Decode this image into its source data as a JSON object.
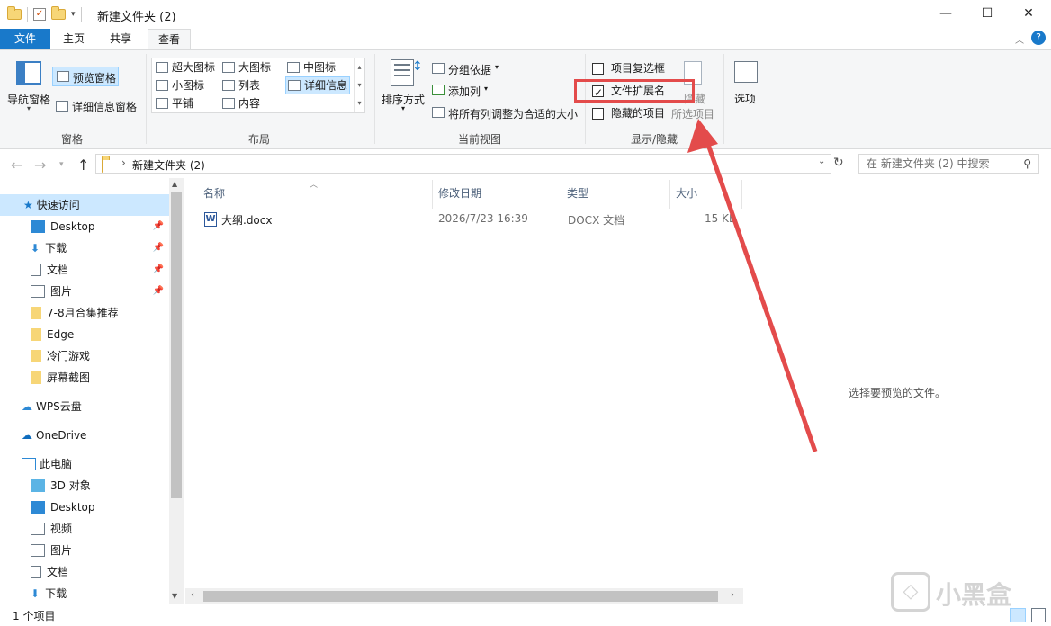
{
  "title": "新建文件夹 (2)",
  "window_controls": {
    "minimize": "—",
    "maximize": "☐",
    "close": "✕"
  },
  "tabs": {
    "file": "文件",
    "home": "主页",
    "share": "共享",
    "view": "查看"
  },
  "ribbon": {
    "panes": {
      "nav_pane": "导航窗格",
      "preview_pane": "预览窗格",
      "details_pane": "详细信息窗格",
      "group": "窗格"
    },
    "layout": {
      "items": [
        "超大图标",
        "大图标",
        "中图标",
        "小图标",
        "列表",
        "详细信息",
        "平铺",
        "内容"
      ],
      "group": "布局"
    },
    "current_view": {
      "sort_by": "排序方式",
      "group_by": "分组依据",
      "add_columns": "添加列",
      "size_all": "将所有列调整为合适的大小",
      "group": "当前视图"
    },
    "show_hide": {
      "item_checkboxes": "项目复选框",
      "file_extensions": "文件扩展名",
      "hidden_items": "隐藏的项目",
      "hide_selected_1": "隐藏",
      "hide_selected_2": "所选项目",
      "group": "显示/隐藏",
      "file_extensions_checked": true,
      "item_checkboxes_checked": false,
      "hidden_items_checked": false
    },
    "options": "选项"
  },
  "address": {
    "path": "新建文件夹 (2)",
    "search_placeholder": "在 新建文件夹 (2) 中搜索"
  },
  "sidebar": {
    "items": [
      {
        "label": "快速访问",
        "icon": "star-icon"
      },
      {
        "label": "Desktop",
        "icon": "desktop-icon",
        "pinned": true
      },
      {
        "label": "下载",
        "icon": "download-icon",
        "pinned": true
      },
      {
        "label": "文档",
        "icon": "document-icon",
        "pinned": true
      },
      {
        "label": "图片",
        "icon": "picture-icon",
        "pinned": true
      },
      {
        "label": "7-8月合集推荐",
        "icon": "folder-icon"
      },
      {
        "label": "Edge",
        "icon": "folder-icon"
      },
      {
        "label": "冷门游戏",
        "icon": "folder-icon"
      },
      {
        "label": "屏幕截图",
        "icon": "folder-icon"
      },
      {
        "label": "WPS云盘",
        "icon": "cloud-icon"
      },
      {
        "label": "OneDrive",
        "icon": "cloud-icon"
      },
      {
        "label": "此电脑",
        "icon": "computer-icon"
      },
      {
        "label": "3D 对象",
        "icon": "cube-icon"
      },
      {
        "label": "Desktop",
        "icon": "desktop-icon"
      },
      {
        "label": "视频",
        "icon": "video-icon"
      },
      {
        "label": "图片",
        "icon": "picture-icon"
      },
      {
        "label": "文档",
        "icon": "document-icon"
      },
      {
        "label": "下载",
        "icon": "download-icon"
      }
    ]
  },
  "columns": {
    "name": "名称",
    "date": "修改日期",
    "type": "类型",
    "size": "大小"
  },
  "files": [
    {
      "name": "大纲.docx",
      "date": "2026/7/23 16:39",
      "type": "DOCX 文档",
      "size": "15 KB"
    }
  ],
  "preview_message": "选择要预览的文件。",
  "status": {
    "count": "1 个项目"
  },
  "watermark": "小黑盒",
  "colors": {
    "accent": "#1979ca",
    "highlight": "#e34b4b",
    "selection": "#cce8ff"
  }
}
